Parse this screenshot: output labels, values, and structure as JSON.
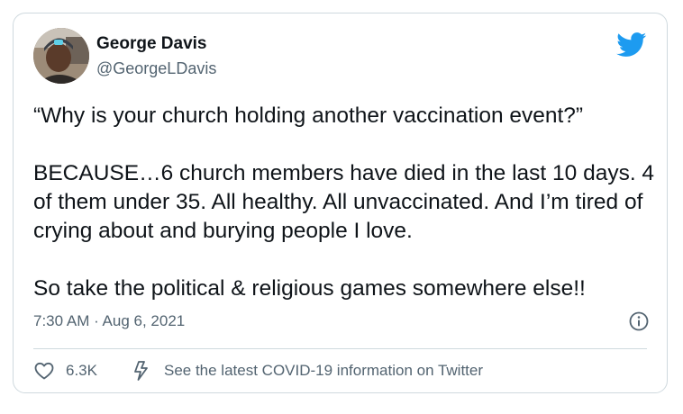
{
  "author": {
    "name": "George Davis",
    "handle": "@GeorgeLDavis"
  },
  "tweet": {
    "paragraphs": [
      "“Why is your church holding another vaccination event?”",
      "BECAUSE…6 church members have died in the last 10 days. 4 of them under 35. All healthy. All unvaccinated. And I’m tired of crying about and burying people I love.",
      "So take the political & religious games somewhere else!!"
    ],
    "timestamp": "7:30 AM · Aug 6, 2021"
  },
  "actions": {
    "like_count": "6.3K",
    "info_link_label": "See the latest COVID-19 information on Twitter"
  },
  "icons": {
    "logo": "twitter-bird-icon",
    "info": "info-circle-icon",
    "like": "heart-icon",
    "info_link": "lightning-bolt-icon"
  },
  "colors": {
    "twitter_blue": "#1d9bf0",
    "text_primary": "#0f1419",
    "text_secondary": "#536471",
    "border": "#cfd9de"
  }
}
